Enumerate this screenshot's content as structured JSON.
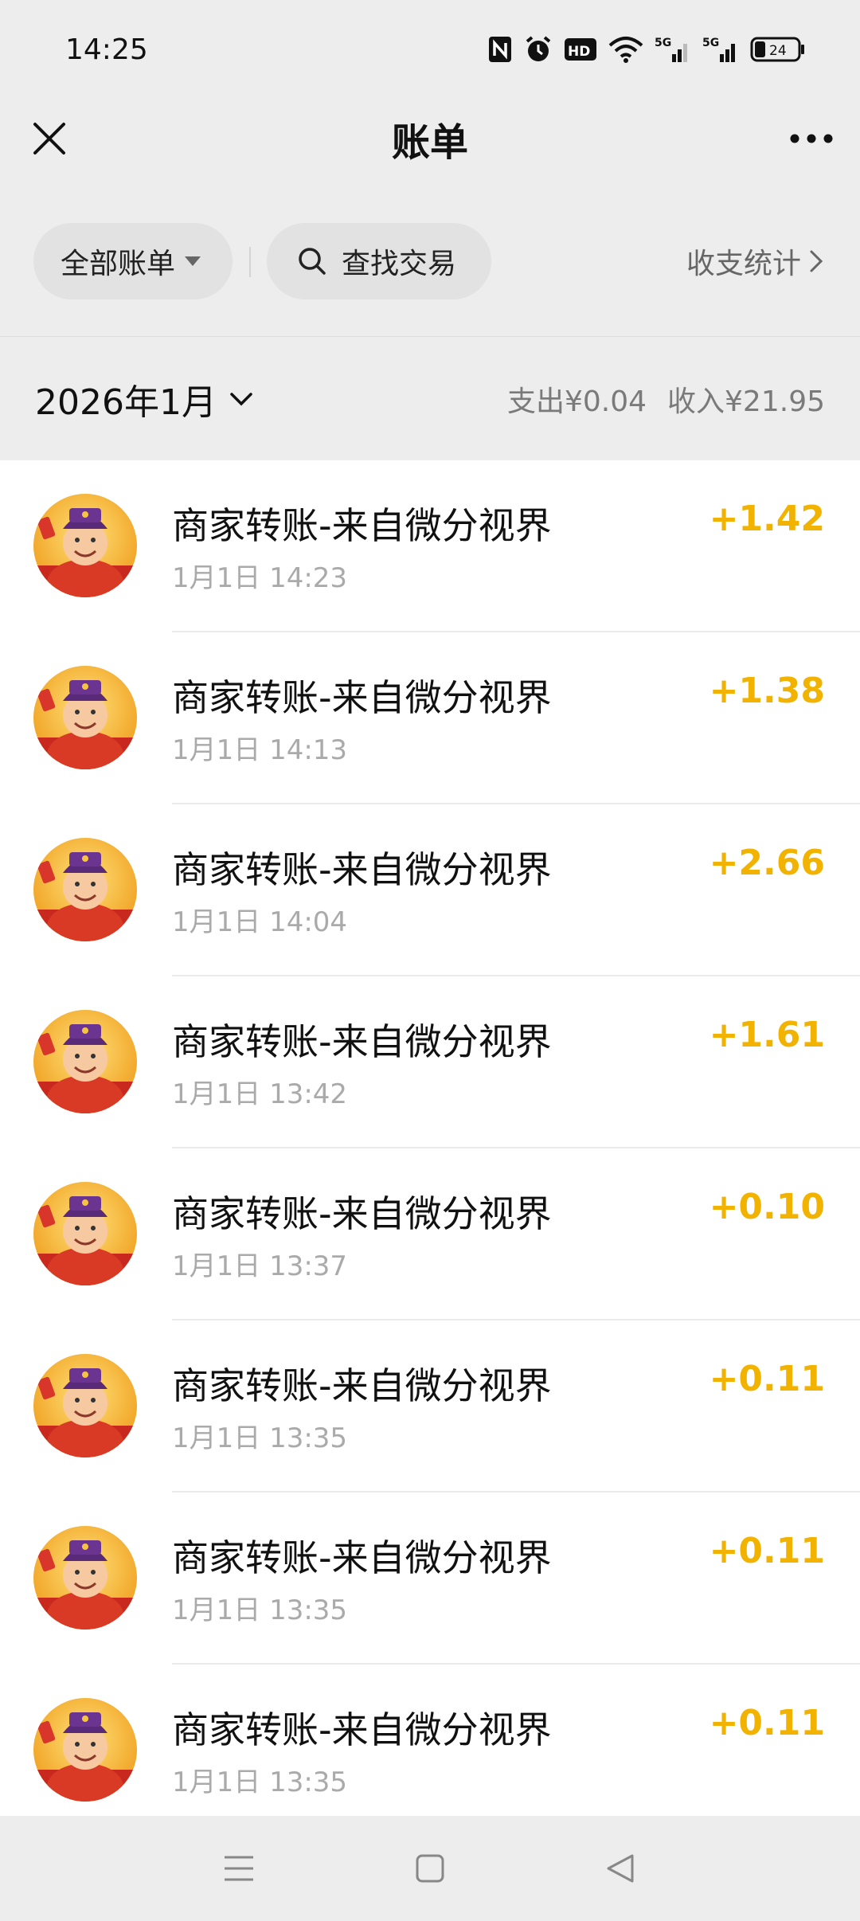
{
  "status_bar": {
    "time": "14:25",
    "icons": [
      "nfc-icon",
      "alarm-icon",
      "hd-icon",
      "wifi-icon",
      "signal-5g-icon",
      "signal-5g-icon",
      "battery-icon"
    ],
    "battery": "24"
  },
  "nav": {
    "title": "账单",
    "close_icon": "close-icon",
    "more_icon": "more-icon"
  },
  "filters": {
    "all_bills": "全部账单",
    "search": "查找交易",
    "stats": "收支统计"
  },
  "summary": {
    "month": "2026年1月",
    "expense": "支出¥0.04",
    "income": "收入¥21.95"
  },
  "transactions": [
    {
      "title": "商家转账-来自微分视界",
      "time": "1月1日 14:23",
      "amount": "+1.42"
    },
    {
      "title": "商家转账-来自微分视界",
      "time": "1月1日 14:13",
      "amount": "+1.38"
    },
    {
      "title": "商家转账-来自微分视界",
      "time": "1月1日 14:04",
      "amount": "+2.66"
    },
    {
      "title": "商家转账-来自微分视界",
      "time": "1月1日 13:42",
      "amount": "+1.61"
    },
    {
      "title": "商家转账-来自微分视界",
      "time": "1月1日 13:37",
      "amount": "+0.10"
    },
    {
      "title": "商家转账-来自微分视界",
      "time": "1月1日 13:35",
      "amount": "+0.11"
    },
    {
      "title": "商家转账-来自微分视界",
      "time": "1月1日 13:35",
      "amount": "+0.11"
    },
    {
      "title": "商家转账-来自微分视界",
      "time": "1月1日 13:35",
      "amount": "+0.11"
    }
  ],
  "colors": {
    "accent_amount": "#f2b300",
    "background": "#ededed",
    "list_background": "#ffffff"
  },
  "bottom_nav": [
    "menu-icon",
    "home-icon",
    "back-icon"
  ]
}
